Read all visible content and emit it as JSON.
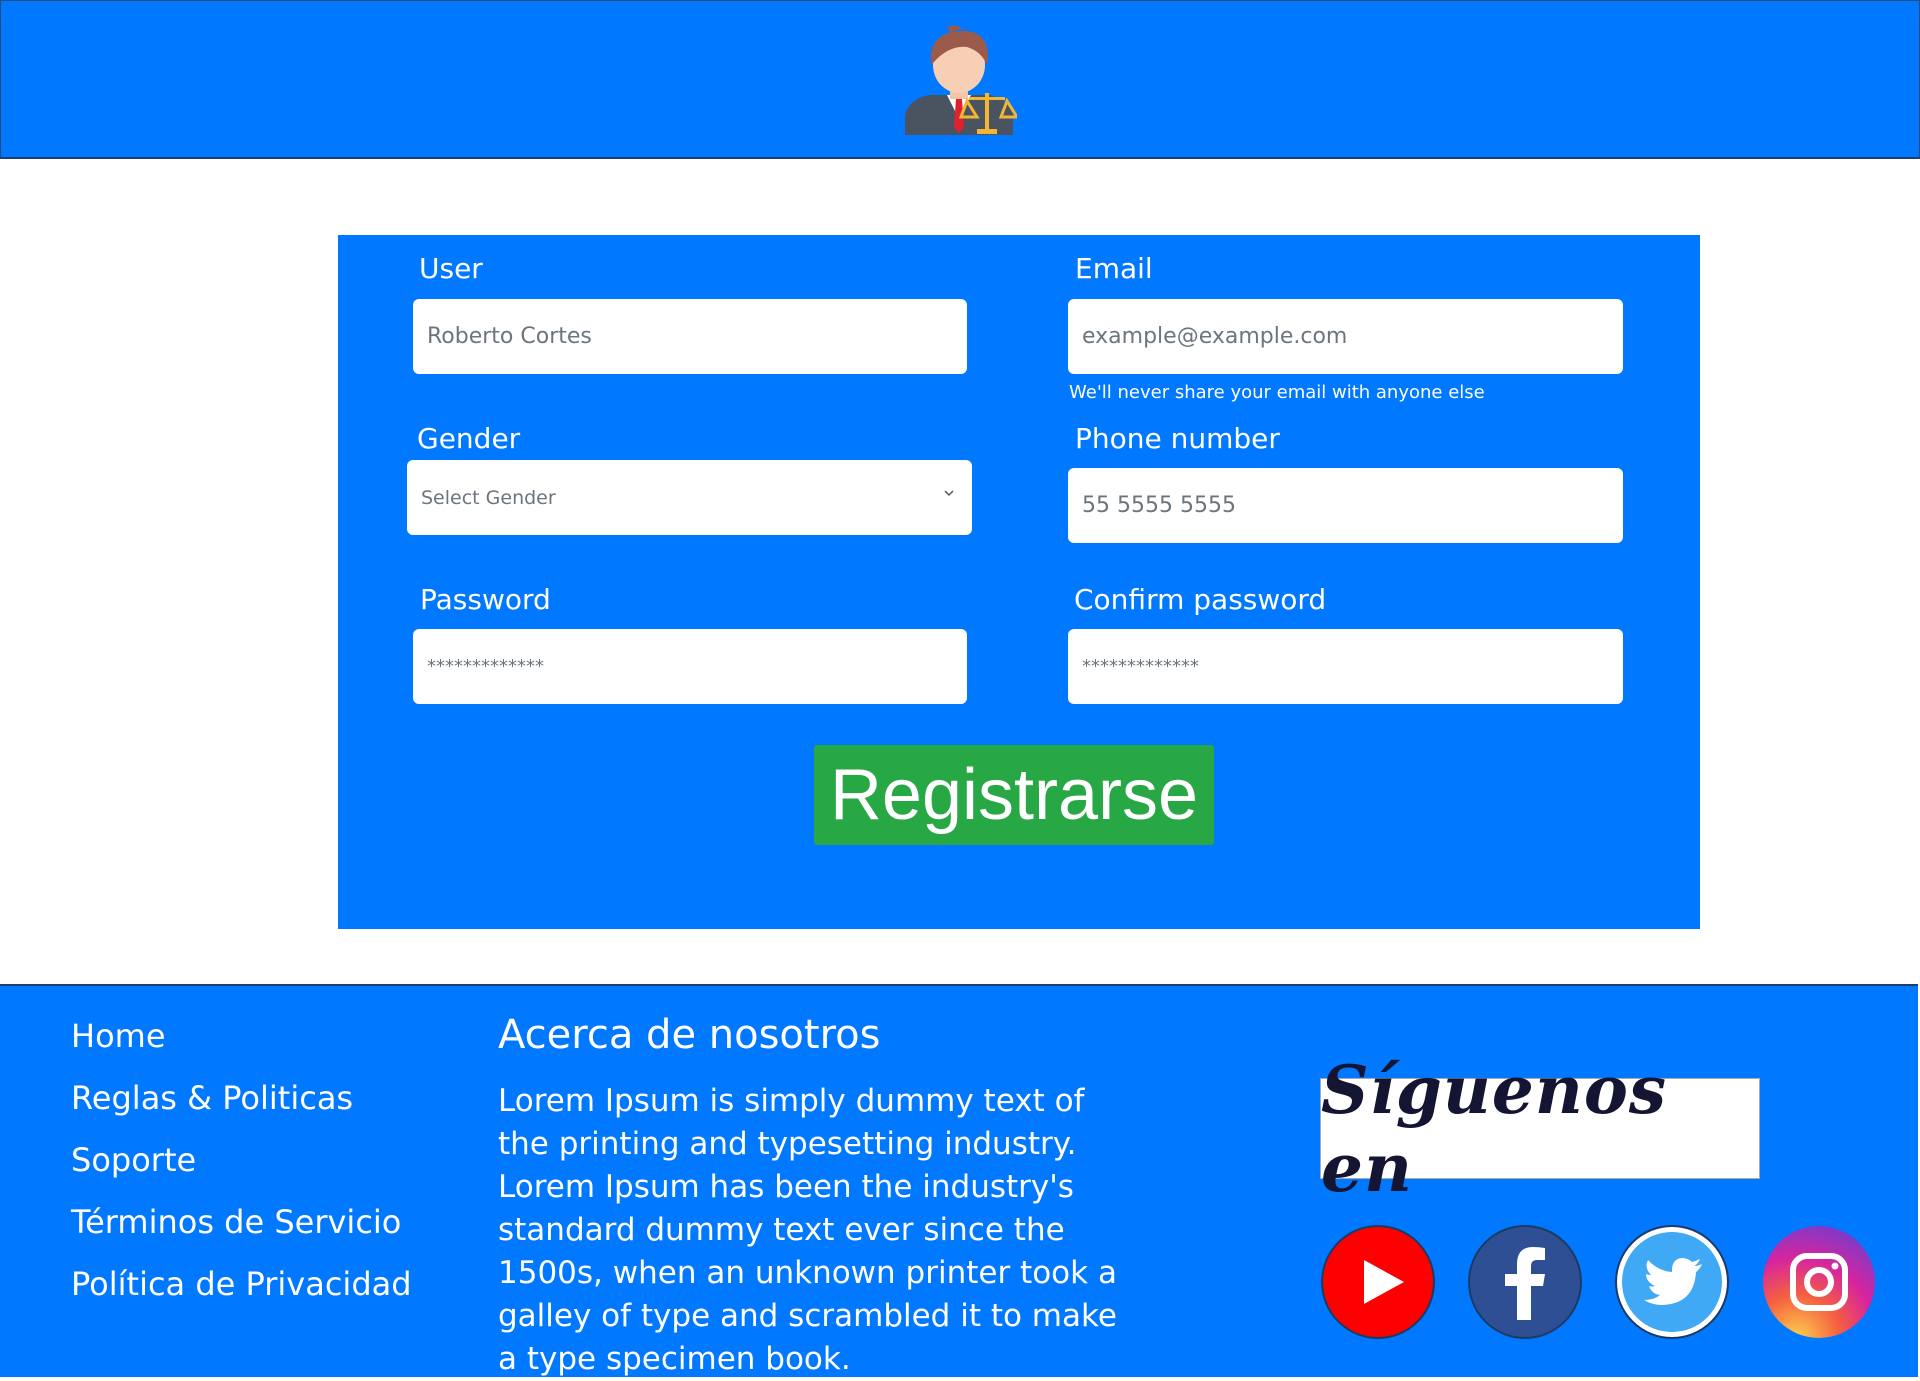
{
  "header": {
    "logo_icon": "lawyer-avatar-icon"
  },
  "form": {
    "user_label": "User",
    "user_placeholder": "Roberto Cortes",
    "email_label": "Email",
    "email_placeholder": "example@example.com",
    "email_help": "We'll never share your email with anyone else",
    "gender_label": "Gender",
    "gender_selected": "Select Gender",
    "phone_label": "Phone number",
    "phone_placeholder": "55 5555 5555",
    "password_label": "Password",
    "password_placeholder": "*************",
    "confirm_label": "Confirm password",
    "confirm_placeholder": "*************",
    "submit_label": "Registrarse"
  },
  "footer": {
    "links": [
      "Home",
      "Reglas & Politicas",
      "Soporte",
      "Términos de Servicio",
      "Política de Privacidad"
    ],
    "about_title": "Acerca de nosotros",
    "about_text": "Lorem Ipsum is simply dummy text of the printing and typesetting industry. Lorem Ipsum has been the industry's standard dummy text ever since the 1500s, when an unknown printer took a galley of type and scrambled it to make a type specimen book.",
    "follow_label": "Síguenos en",
    "social": [
      "youtube-icon",
      "facebook-icon",
      "twitter-icon",
      "instagram-icon"
    ]
  },
  "colors": {
    "primary": "#0078ff",
    "success": "#28a745"
  }
}
